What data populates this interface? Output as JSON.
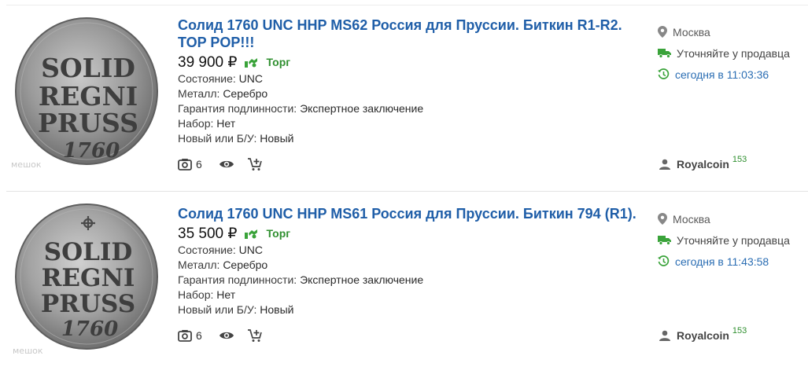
{
  "listings": [
    {
      "title": "Солид 1760 UNC HHP MS62 Россия для Пруссии. Биткин R1-R2. TOP POP!!!",
      "price": "39 900 ₽",
      "bargain_label": "Торг",
      "properties": [
        {
          "key": "Состояние:",
          "value": "UNC"
        },
        {
          "key": "Металл:",
          "value": "Серебро"
        },
        {
          "key": "Гарантия подлинности:",
          "value": "Экспертное заключение"
        },
        {
          "key": "Набор:",
          "value": "Нет"
        },
        {
          "key": "Новый или Б/У:",
          "value": "Новый"
        }
      ],
      "photo_count": "6",
      "location": "Москва",
      "delivery": "Уточняйте у продавца",
      "time": "сегодня в 11:03:36",
      "seller": {
        "name": "Royalcoin",
        "rating": "153"
      },
      "coin": {
        "lines": [
          "SOLID",
          "REGNI",
          "PRUSS",
          "1760"
        ],
        "watermark": "мешок"
      }
    },
    {
      "title": "Солид 1760 UNC HHP MS61 Россия для Пруссии. Биткин 794 (R1).",
      "price": "35 500 ₽",
      "bargain_label": "Торг",
      "properties": [
        {
          "key": "Состояние:",
          "value": "UNC"
        },
        {
          "key": "Металл:",
          "value": "Серебро"
        },
        {
          "key": "Гарантия подлинности:",
          "value": "Экспертное заключение"
        },
        {
          "key": "Набор:",
          "value": "Нет"
        },
        {
          "key": "Новый или Б/У:",
          "value": "Новый"
        }
      ],
      "photo_count": "6",
      "location": "Москва",
      "delivery": "Уточняйте у продавца",
      "time": "сегодня в 11:43:58",
      "seller": {
        "name": "Royalcoin",
        "rating": "153"
      },
      "coin": {
        "lines": [
          "SOLID",
          "REGNI",
          "PRUSS",
          "1760"
        ],
        "watermark": "мешок"
      }
    }
  ],
  "colors": {
    "title": "#1f5ea8",
    "bargain": "#2f8f2f",
    "time": "#2a6db3",
    "rating": "#2f8f2f"
  }
}
